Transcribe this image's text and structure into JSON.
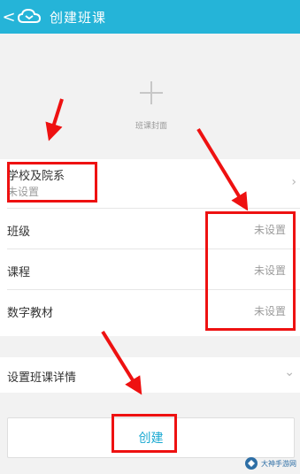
{
  "header": {
    "back_label": "<",
    "title": "创建班课"
  },
  "cover": {
    "label": "班课封面"
  },
  "list": {
    "school": {
      "label": "学校及院系",
      "value": "未设置"
    },
    "class": {
      "label": "班级",
      "value": "未设置"
    },
    "course": {
      "label": "课程",
      "value": "未设置"
    },
    "material": {
      "label": "数字教材",
      "value": "未设置"
    }
  },
  "details": {
    "label": "设置班课详情"
  },
  "create_button": {
    "label": "创建"
  },
  "watermark": {
    "text": "大神手游网"
  },
  "colors": {
    "header": "#25b4d8",
    "accent": "#1aa9d1",
    "annotation": "#e11111"
  }
}
